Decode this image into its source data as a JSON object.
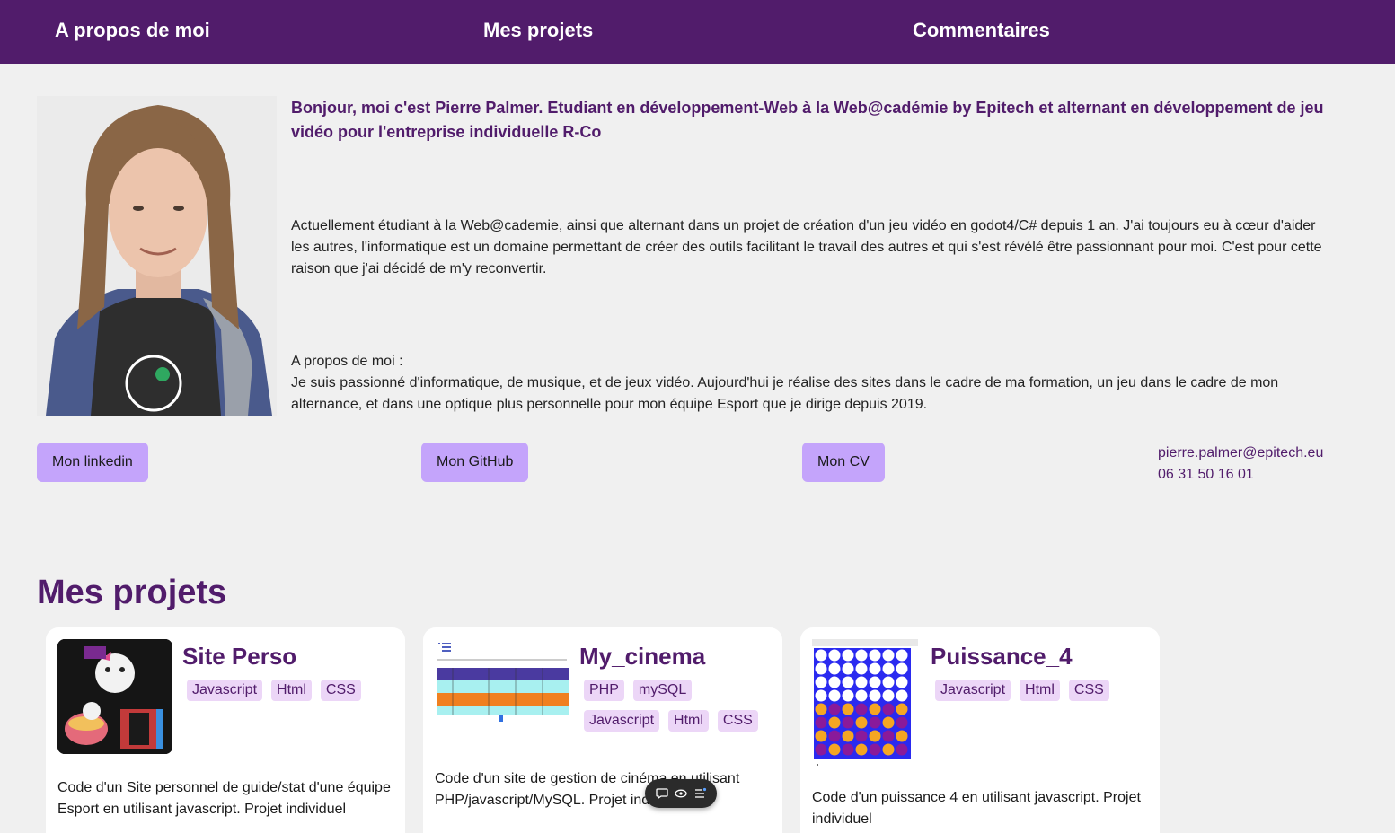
{
  "nav": {
    "about": "A propos de moi",
    "projects": "Mes projets",
    "comments": "Commentaires"
  },
  "about": {
    "intro": "Bonjour, moi c'est Pierre Palmer. Etudiant en développement-Web à la Web@cadémie by Epitech et alternant en développement de jeu vidéo pour l'entreprise individuelle R-Co",
    "paragraph1": "Actuellement étudiant à la Web@cademie, ainsi que alternant dans un projet de création d'un jeu vidéo en godot4/C# depuis 1 an. J'ai toujours eu à cœur d'aider les autres, l'informatique est un domaine permettant de créer des outils facilitant le travail des autres et qui s'est révélé être passionnant pour moi. C'est pour cette raison que j'ai décidé de m'y reconvertir.",
    "paragraph2_heading": "A propos de moi :",
    "paragraph2": "Je suis passionné d'informatique, de musique, et de jeux vidéo. Aujourd'hui je réalise des sites dans le cadre de ma formation, un jeu dans le cadre de mon alternance, et dans une optique plus personnelle pour mon équipe Esport que je dirige depuis 2019."
  },
  "buttons": {
    "linkedin": "Mon linkedin",
    "github": "Mon GitHub",
    "cv": "Mon CV"
  },
  "contact": {
    "email": "pierre.palmer@epitech.eu",
    "phone": "06 31 50 16 01"
  },
  "projects": {
    "title": "Mes projets",
    "items": [
      {
        "title": "Site Perso",
        "tags": [
          "Javascript",
          "Html",
          "CSS"
        ],
        "description": "Code d'un Site personnel de guide/stat d'une équipe Esport en utilisant javascript. Projet individuel"
      },
      {
        "title": "My_cinema",
        "tags": [
          "PHP",
          "mySQL",
          "Javascript",
          "Html",
          "CSS"
        ],
        "description": "Code d'un site de gestion de cinéma en utilisant PHP/javascript/MySQL. Projet individuel"
      },
      {
        "title": "Puissance_4",
        "tags": [
          "Javascript",
          "Html",
          "CSS"
        ],
        "description": "Code d'un puissance 4 en utilisant javascript. Projet individuel"
      }
    ]
  },
  "colors": {
    "primary": "#511c6b",
    "button": "#c4a4fb",
    "tag_bg": "#ecd6f7",
    "background": "#f0f0f0"
  }
}
